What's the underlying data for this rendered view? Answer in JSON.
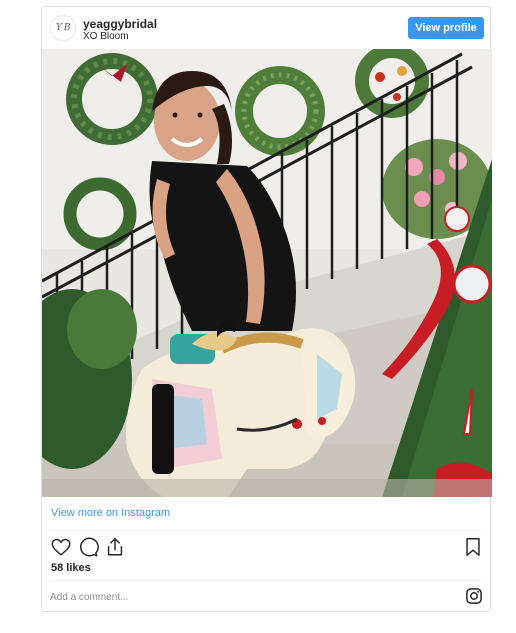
{
  "post": {
    "username": "yeaggybridal",
    "location": "XO Bloom",
    "avatar_monogram": "Y B",
    "view_profile_label": "View profile",
    "view_more_label": "View more on Instagram",
    "likes_text": "58 likes",
    "comment_placeholder": "Add a comment..."
  },
  "icons": {
    "like": "heart-icon",
    "comment": "comment-bubble-icon",
    "share": "share-upload-icon",
    "save": "bookmark-icon",
    "instagram": "instagram-logo-icon"
  },
  "colors": {
    "accent": "#3897f0",
    "border": "#dbdbdb",
    "text": "#262626",
    "muted": "#8e8e8e"
  }
}
